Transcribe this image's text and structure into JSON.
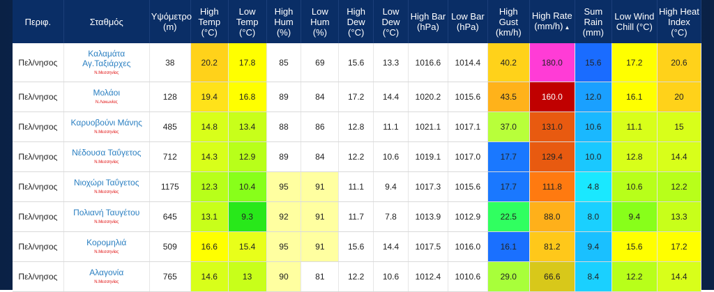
{
  "headers": [
    "Περιφ.",
    "Σταθμός",
    "Υψόμετρο\n(m)",
    "High\nTemp\n(°C)",
    "Low\nTemp\n(°C)",
    "High\nHum\n(%)",
    "Low\nHum\n(%)",
    "High\nDew\n(°C)",
    "Low\nDew\n(°C)",
    "High Bar\n(hPa)",
    "Low Bar\n(hPa)",
    "High Gust\n(km/h)",
    "High Rate\n(mm/h)",
    "Sum\nRain\n(mm)",
    "Low Wind\nChill (°C)",
    "High Heat\nIndex (°C)"
  ],
  "sort_indicator": "▲",
  "rows": [
    {
      "region": "Πελ/νησος",
      "station": "Καλαμάτα\nΑγ.Ταξιάρχες",
      "prefecture": "Ν.Μεσσηνίας",
      "values": [
        "38",
        "20.2",
        "17.8",
        "85",
        "69",
        "15.6",
        "13.3",
        "1016.6",
        "1014.4",
        "40.2",
        "180.0",
        "15.6",
        "17.2",
        "20.6"
      ],
      "colors": [
        "#ffffff",
        "#ffd21a",
        "#ffff00",
        "#ffffff",
        "#ffffff",
        "#ffffff",
        "#ffffff",
        "#ffffff",
        "#ffffff",
        "#ffd21a",
        "#ff3cd6",
        "#1a6cff",
        "#ffff00",
        "#ffd21a"
      ]
    },
    {
      "region": "Πελ/νησος",
      "station": "Μολάοι",
      "prefecture": "Ν.Λακωνίας",
      "values": [
        "128",
        "19.4",
        "16.8",
        "89",
        "84",
        "17.2",
        "14.4",
        "1020.2",
        "1015.6",
        "43.5",
        "160.0",
        "12.0",
        "16.1",
        "20"
      ],
      "colors": [
        "#ffffff",
        "#ffe21a",
        "#ffff00",
        "#ffffff",
        "#ffffff",
        "#ffffff",
        "#ffffff",
        "#ffffff",
        "#ffffff",
        "#ffb21a",
        "#c00000",
        "#1aa0ff",
        "#ffff00",
        "#ffd21a"
      ]
    },
    {
      "region": "Πελ/νησος",
      "station": "Καρυοβούνι Μάνης",
      "prefecture": "Ν.Μεσσηνίας",
      "values": [
        "485",
        "14.8",
        "13.4",
        "88",
        "86",
        "12.8",
        "11.1",
        "1021.1",
        "1017.1",
        "37.0",
        "131.0",
        "10.6",
        "11.1",
        "15"
      ],
      "colors": [
        "#ffffff",
        "#d8ff1a",
        "#c8ff1a",
        "#ffffff",
        "#ffffff",
        "#ffffff",
        "#ffffff",
        "#ffffff",
        "#ffffff",
        "#b8ff3a",
        "#e85a10",
        "#1ab8ff",
        "#d8ff1a",
        "#d8ff1a"
      ]
    },
    {
      "region": "Πελ/νησος",
      "station": "Νέδουσα Ταΰγετος",
      "prefecture": "Ν.Μεσσηνίας",
      "values": [
        "712",
        "14.3",
        "12.9",
        "89",
        "84",
        "12.2",
        "10.6",
        "1019.1",
        "1017.0",
        "17.7",
        "129.4",
        "10.0",
        "12.8",
        "14.4"
      ],
      "colors": [
        "#ffffff",
        "#d8ff1a",
        "#b8ff1a",
        "#ffffff",
        "#ffffff",
        "#ffffff",
        "#ffffff",
        "#ffffff",
        "#ffffff",
        "#1a78ff",
        "#e85a10",
        "#1ac8ff",
        "#d8ff1a",
        "#d8ff1a"
      ]
    },
    {
      "region": "Πελ/νησος",
      "station": "Νιοχώρι Ταΰγετος",
      "prefecture": "Ν.Μεσσηνίας",
      "values": [
        "1175",
        "12.3",
        "10.4",
        "95",
        "91",
        "11.1",
        "9.4",
        "1017.3",
        "1015.6",
        "17.7",
        "111.8",
        "4.8",
        "10.6",
        "12.2"
      ],
      "colors": [
        "#ffffff",
        "#b8ff1a",
        "#88ff1a",
        "#ffffa0",
        "#ffffa0",
        "#ffffff",
        "#ffffff",
        "#ffffff",
        "#ffffff",
        "#1a78ff",
        "#ff7a10",
        "#1ae8ff",
        "#b8ff1a",
        "#b8ff1a"
      ]
    },
    {
      "region": "Πελ/νησος",
      "station": "Πολιανή Ταυγέτου",
      "prefecture": "Ν.Μεσσηνίας",
      "values": [
        "645",
        "13.1",
        "9.3",
        "92",
        "91",
        "11.7",
        "7.8",
        "1013.9",
        "1012.9",
        "22.5",
        "88.0",
        "8.0",
        "9.4",
        "13.3"
      ],
      "colors": [
        "#ffffff",
        "#c8ff1a",
        "#28e81a",
        "#ffffa0",
        "#ffffa0",
        "#ffffff",
        "#ffffff",
        "#ffffff",
        "#ffffff",
        "#30ff60",
        "#ffb01a",
        "#1ad0ff",
        "#88ff1a",
        "#c8ff1a"
      ]
    },
    {
      "region": "Πελ/νησος",
      "station": "Κορομηλιά",
      "prefecture": "Ν.Μεσσηνίας",
      "values": [
        "509",
        "16.6",
        "15.4",
        "95",
        "91",
        "15.6",
        "14.4",
        "1017.5",
        "1016.0",
        "16.1",
        "81.2",
        "9.4",
        "15.6",
        "17.2"
      ],
      "colors": [
        "#ffffff",
        "#ffff00",
        "#e8ff1a",
        "#ffffa0",
        "#ffffa0",
        "#ffffff",
        "#ffffff",
        "#ffffff",
        "#ffffff",
        "#1a70ff",
        "#ffc81a",
        "#1ac0ff",
        "#ffff00",
        "#ffff00"
      ]
    },
    {
      "region": "Πελ/νησος",
      "station": "Αλαγονία",
      "prefecture": "Ν.Μεσσηνίας",
      "values": [
        "765",
        "14.6",
        "13",
        "90",
        "81",
        "12.2",
        "10.6",
        "1012.4",
        "1010.6",
        "29.0",
        "66.6",
        "8.4",
        "12.2",
        "14.4"
      ],
      "colors": [
        "#ffffff",
        "#d8ff1a",
        "#c8ff1a",
        "#ffffa0",
        "#ffffff",
        "#ffffff",
        "#ffffff",
        "#ffffff",
        "#ffffff",
        "#a8ff3a",
        "#d8c81a",
        "#1ad0ff",
        "#b8ff1a",
        "#d8ff1a"
      ]
    }
  ]
}
